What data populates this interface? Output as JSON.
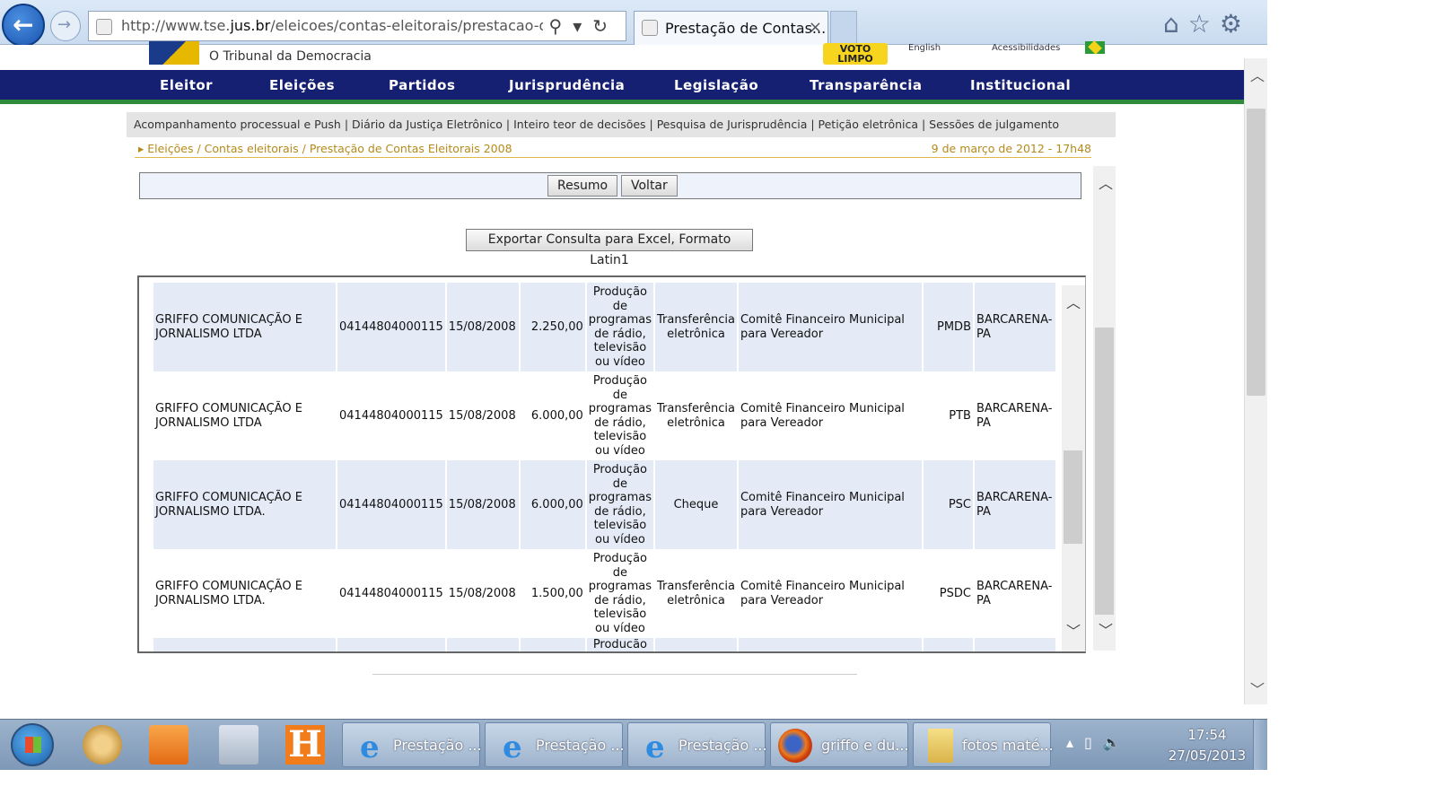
{
  "browser": {
    "url_prefix": "http://www.tse.",
    "url_domain": "jus.br",
    "url_rest": "/eleicoes/contas-eleitorais/prestacao-de-cor",
    "tab_title": "Prestação de Contas...",
    "tab_close": "×"
  },
  "site": {
    "tagline": "O Tribunal da Democracia",
    "voto_limpo": "VOTO LIMPO",
    "english": "English",
    "acessibilidades": "Acessibilidades"
  },
  "nav": {
    "items": [
      "Eleitor",
      "Eleições",
      "Partidos",
      "Jurisprudência",
      "Legislação",
      "Transparência",
      "Institucional"
    ]
  },
  "subnav": {
    "text": "Acompanhamento processual e Push   |   Diário da Justiça Eletrônico   |   Inteiro teor de decisões   |   Pesquisa de Jurisprudência   |   Petição eletrônica   |   Sessões de julgamento"
  },
  "breadcrumb": {
    "path": "▸ Eleições / Contas eleitorais / Prestação de Contas Eleitorais 2008",
    "date": "9 de março de 2012 - 17h48"
  },
  "buttons": {
    "resumo": "Resumo",
    "voltar": "Voltar",
    "export": "Exportar Consulta para Excel, Formato Latin1"
  },
  "table": {
    "rows": [
      {
        "name": "GRIFFO COMUNICAÇÃO E JORNALISMO LTDA",
        "cnpj": "04144804000115",
        "date": "15/08/2008",
        "value": "2.250,00",
        "desc": "Produção de programas de rádio, televisão ou vídeo",
        "tipo": "Transferência eletrônica",
        "dest": "Comitê Financeiro Municipal para Vereador",
        "partido": "PMDB",
        "municipio": "BARCARENA-PA"
      },
      {
        "name": "GRIFFO COMUNICAÇÃO E JORNALISMO LTDA",
        "cnpj": "04144804000115",
        "date": "15/08/2008",
        "value": "6.000,00",
        "desc": "Produção de programas de rádio, televisão ou vídeo",
        "tipo": "Transferência eletrônica",
        "dest": "Comitê Financeiro Municipal para Vereador",
        "partido": "PTB",
        "municipio": "BARCARENA-PA"
      },
      {
        "name": "GRIFFO COMUNICAÇÃO E JORNALISMO LTDA.",
        "cnpj": "04144804000115",
        "date": "15/08/2008",
        "value": "6.000,00",
        "desc": "Produção de programas de rádio, televisão ou vídeo",
        "tipo": "Cheque",
        "dest": "Comitê Financeiro Municipal para Vereador",
        "partido": "PSC",
        "municipio": "BARCARENA-PA"
      },
      {
        "name": "GRIFFO COMUNICAÇÃO E JORNALISMO LTDA.",
        "cnpj": "04144804000115",
        "date": "15/08/2008",
        "value": "1.500,00",
        "desc": "Produção de programas de rádio, televisão ou vídeo",
        "tipo": "Transferência eletrônica",
        "dest": "Comitê Financeiro Municipal para Vereador",
        "partido": "PSDC",
        "municipio": "BARCARENA-PA"
      }
    ],
    "partial_row_desc": "Producão"
  },
  "taskbar": {
    "tasks": [
      "Prestação ...",
      "Prestação ...",
      "Prestação ...",
      "griffo e du...",
      "fotos maté..."
    ],
    "time": "17:54",
    "date": "27/05/2013"
  },
  "icons": {
    "back": "back-arrow-icon",
    "forward": "forward-arrow-icon",
    "home": "home-icon",
    "favorites": "star-icon",
    "tools": "gear-icon"
  }
}
